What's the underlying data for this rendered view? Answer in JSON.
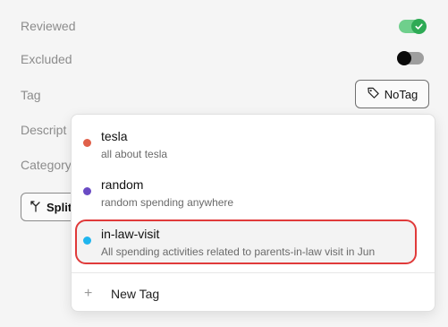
{
  "fields": {
    "reviewed_label": "Reviewed",
    "excluded_label": "Excluded",
    "tag_label": "Tag",
    "description_label": "Descript",
    "category_label": "Category"
  },
  "toggles": {
    "reviewed": true,
    "excluded": false
  },
  "tag_button": {
    "label": "NoTag",
    "icon": "tag-icon"
  },
  "split_button": {
    "label": "Split",
    "icon": "split-icon"
  },
  "dropdown": {
    "options": [
      {
        "name": "tesla",
        "description": "all about tesla",
        "color": "#e0604a"
      },
      {
        "name": "random",
        "description": "random spending anywhere",
        "color": "#6a4bc4"
      },
      {
        "name": "in-law-visit",
        "description": "All spending activities related to parents-in-law visit in Jun",
        "color": "#1fb5ee"
      }
    ],
    "new_tag_label": "New Tag"
  },
  "colors": {
    "toggle_on": "#2eaa55",
    "highlight_border": "#e03a3a"
  }
}
